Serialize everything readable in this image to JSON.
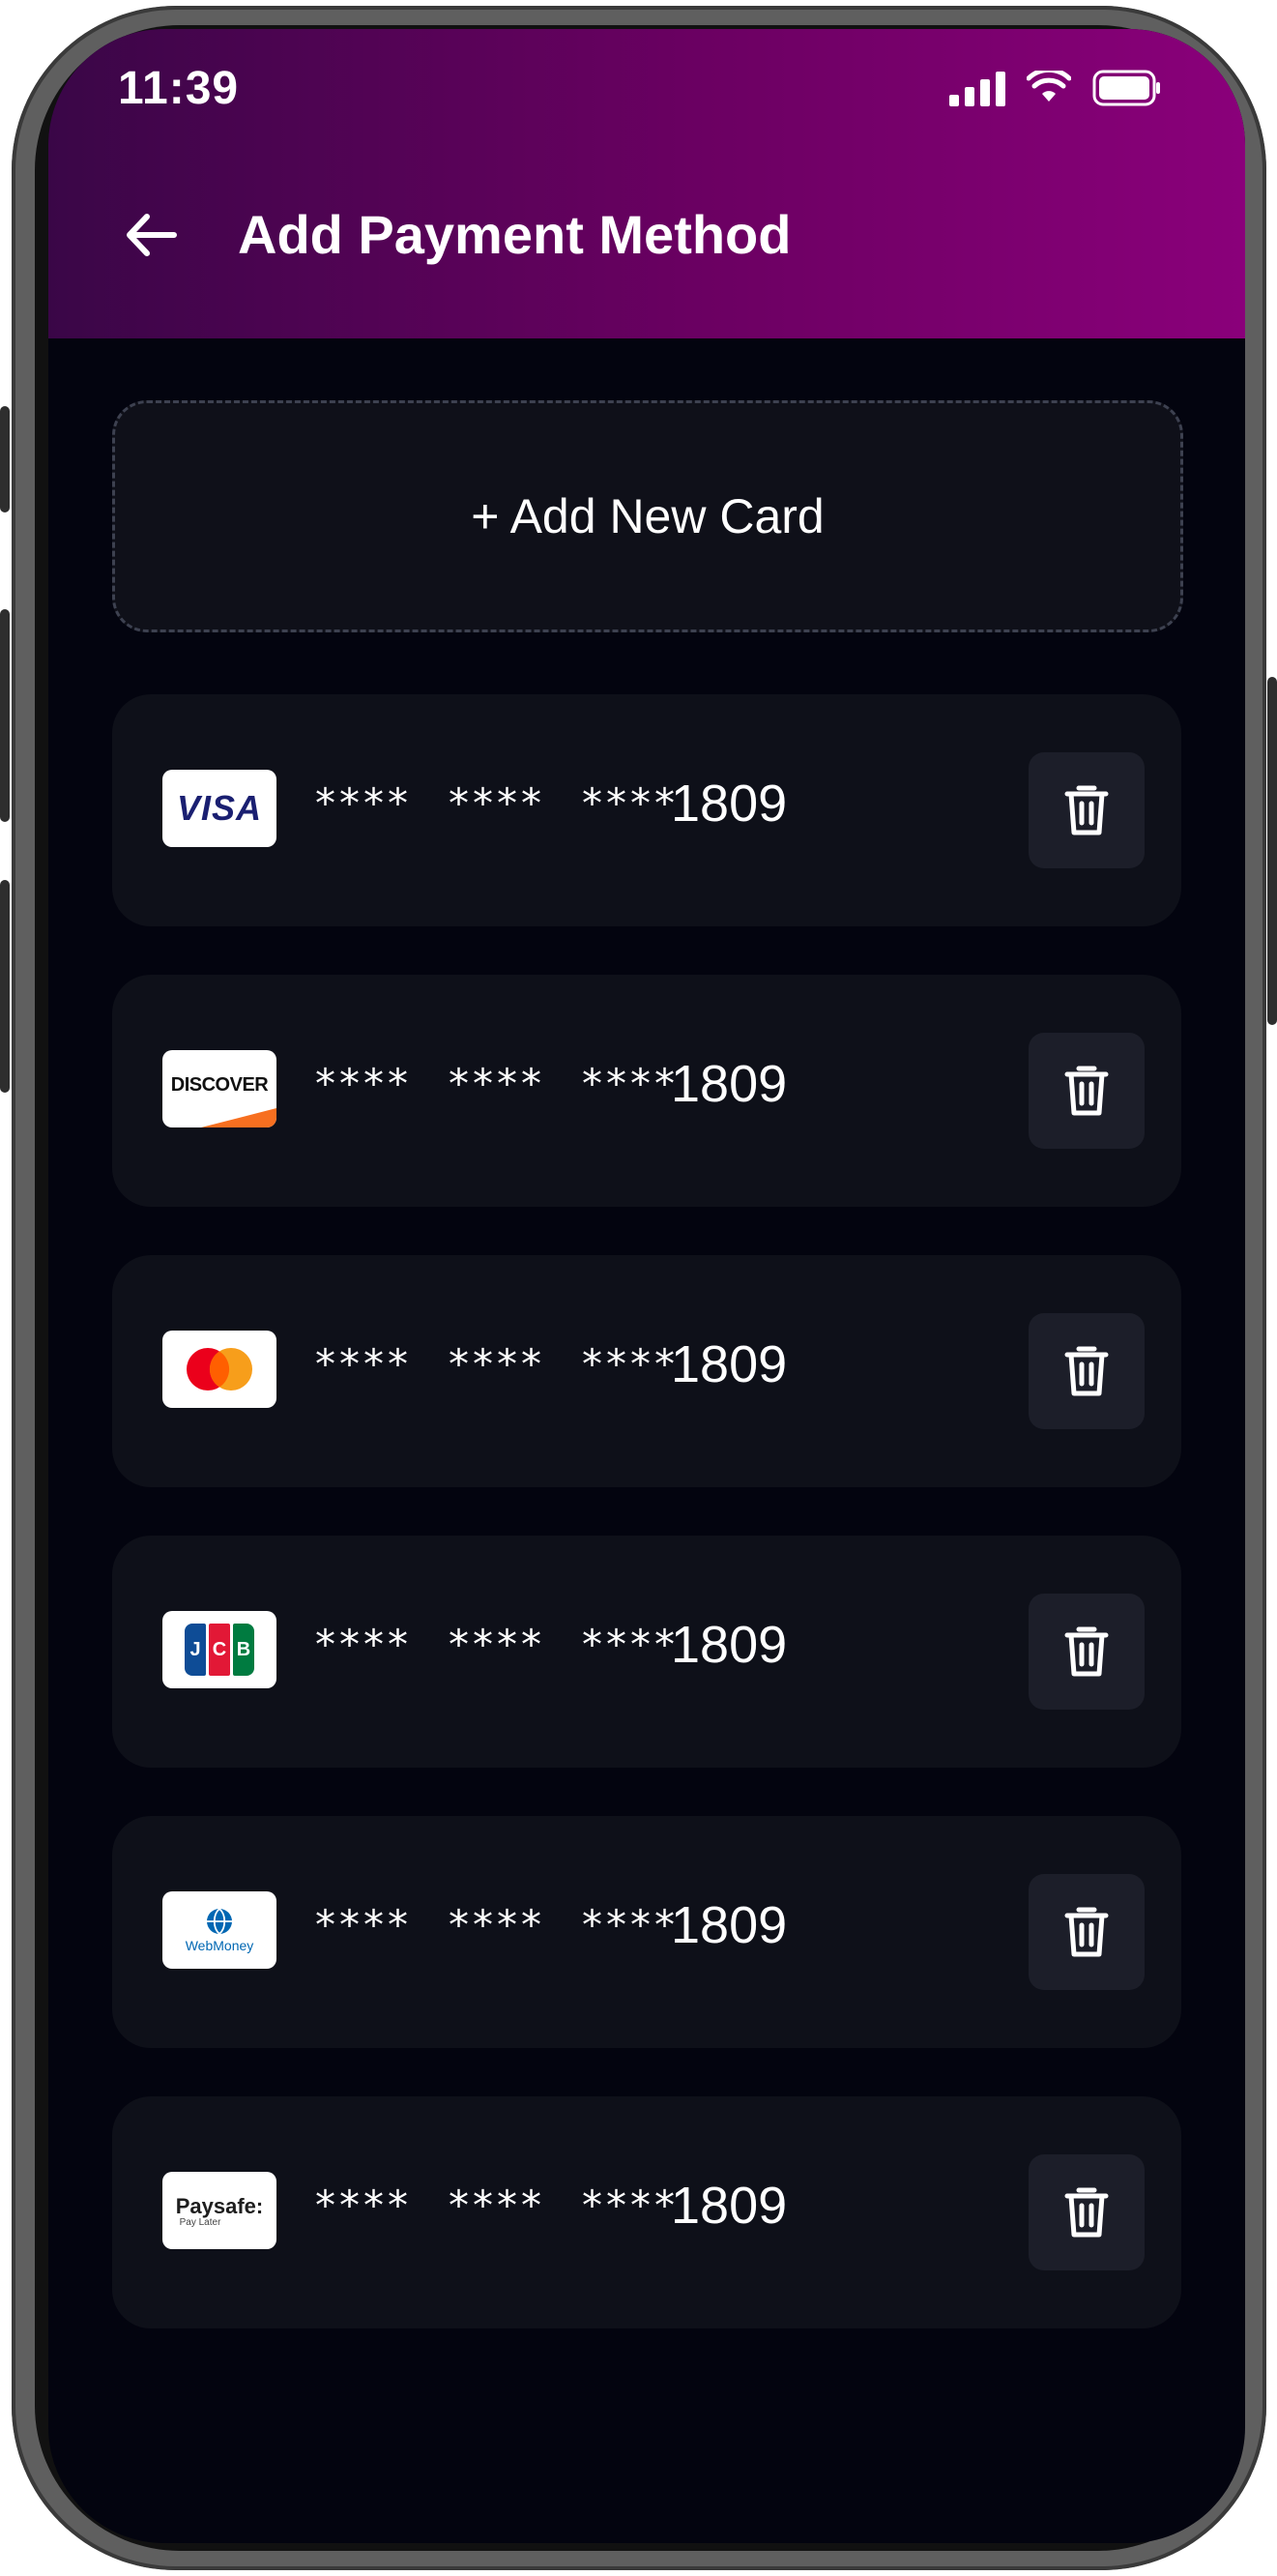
{
  "status_bar": {
    "time": "11:39"
  },
  "header": {
    "title": "Add Payment Method",
    "back_icon": "arrow-left-icon"
  },
  "add_card": {
    "label": "+ Add New Card"
  },
  "cards": [
    {
      "brand": "VISA",
      "logo_text": "VISA",
      "mask": [
        "****",
        "****",
        "****"
      ],
      "last4": "1809"
    },
    {
      "brand": "DISCOVER",
      "logo_text": "DISCOVER",
      "mask": [
        "****",
        "****",
        "****"
      ],
      "last4": "1809"
    },
    {
      "brand": "Mastercard",
      "logo_text": "",
      "mask": [
        "****",
        "****",
        "****"
      ],
      "last4": "1809"
    },
    {
      "brand": "JCB",
      "logo_text": "JCB",
      "mask": [
        "****",
        "****",
        "****"
      ],
      "last4": "1809"
    },
    {
      "brand": "WebMoney",
      "logo_text": "WebMoney",
      "mask": [
        "****",
        "****",
        "****"
      ],
      "last4": "1809"
    },
    {
      "brand": "Paysafe",
      "logo_text": "Paysafe:",
      "logo_sub": "Pay Later",
      "mask": [
        "****",
        "****",
        "****"
      ],
      "last4": "1809"
    }
  ],
  "colors": {
    "header_start": "#3a0647",
    "header_end": "#8a007a",
    "background": "#03040f",
    "card_bg": "#0e1019",
    "delete_bg": "#1c1e29"
  }
}
